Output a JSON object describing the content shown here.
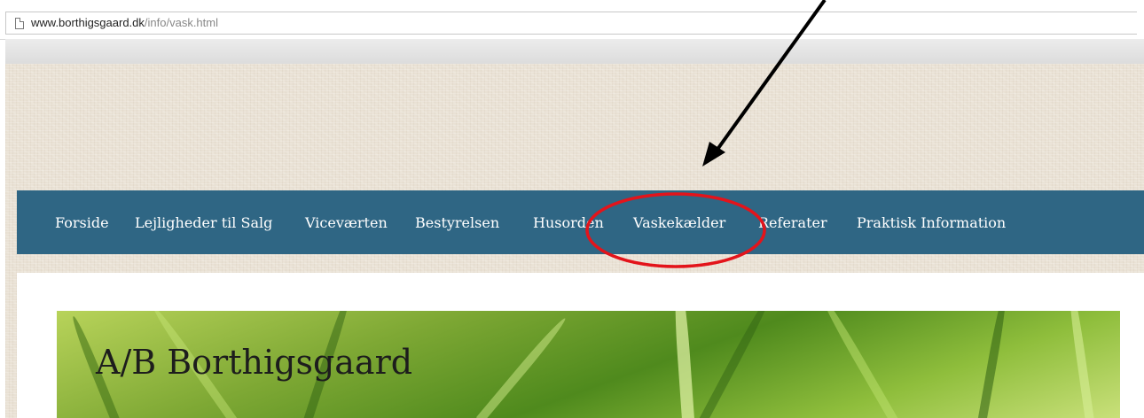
{
  "browser": {
    "url_host": "www.borthigsgaard.dk",
    "url_path": "/info/vask.html"
  },
  "nav": {
    "items": [
      {
        "label": "Forside"
      },
      {
        "label": "Lejligheder til Salg"
      },
      {
        "label": "Viceværten"
      },
      {
        "label": "Bestyrelsen"
      },
      {
        "label": "Husorden"
      },
      {
        "label": "Vaskekælder"
      },
      {
        "label": "Referater"
      },
      {
        "label": "Praktisk Information"
      }
    ]
  },
  "site": {
    "title": "A/B Borthigsgaard"
  },
  "colors": {
    "nav_background": "#2f6684",
    "annotation_circle": "#e3141b",
    "annotation_arrow": "#000000"
  }
}
